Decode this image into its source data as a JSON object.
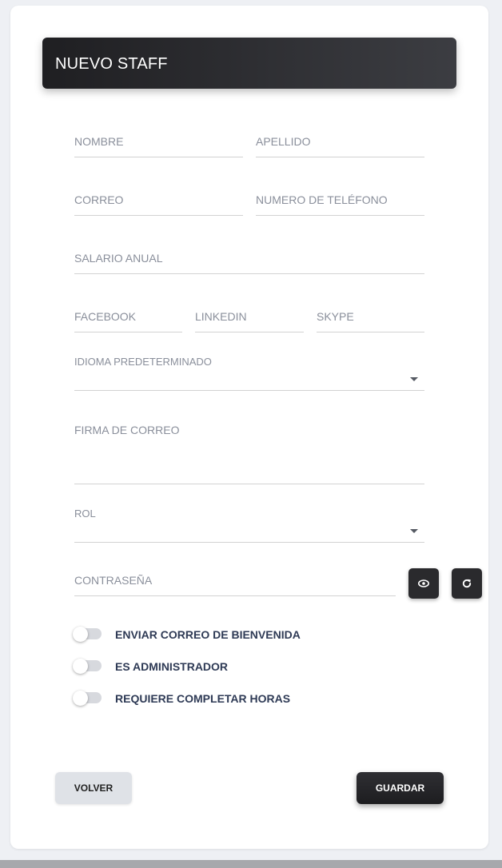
{
  "header": {
    "title": "NUEVO STAFF"
  },
  "fields": {
    "first_name": "NOMBRE",
    "last_name": "APELLIDO",
    "email": "CORREO",
    "phone": "NUMERO DE TELÉFONO",
    "salary": "SALARIO ANUAL",
    "facebook": "FACEBOOK",
    "linkedin": "LINKEDIN",
    "skype": "SKYPE",
    "language": "IDIOMA PREDETERMINADO",
    "signature": "FIRMA DE CORREO",
    "role": "ROL",
    "password": "CONTRASEÑA"
  },
  "icons": {
    "show_password": "eye-icon",
    "generate_password": "refresh-icon"
  },
  "toggles": [
    {
      "label": "ENVIAR CORREO DE BIENVENIDA",
      "on": false
    },
    {
      "label": "ES ADMINISTRADOR",
      "on": false
    },
    {
      "label": "REQUIERE COMPLETAR HORAS",
      "on": false
    }
  ],
  "buttons": {
    "back": "VOLVER",
    "save": "GUARDAR"
  },
  "colors": {
    "header_dark": "#1f1f22",
    "label_gray": "#8a8f9b",
    "toggle_text": "#2e3a55"
  }
}
